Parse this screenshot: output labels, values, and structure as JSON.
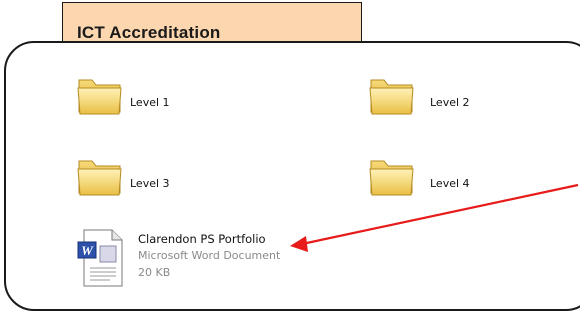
{
  "header": {
    "title": "ICT Accreditation"
  },
  "folders": [
    {
      "label": "Level 1",
      "icon": "folder-icon"
    },
    {
      "label": "Level 2",
      "icon": "folder-icon"
    },
    {
      "label": "Level 3",
      "icon": "folder-icon"
    },
    {
      "label": "Level 4",
      "icon": "folder-icon"
    }
  ],
  "document": {
    "name": "Clarendon PS Portfolio",
    "type": "Microsoft Word Document",
    "size": "20 KB",
    "icon": "word-document-icon"
  },
  "annotation": {
    "arrow_color": "#e81b1b"
  },
  "colors": {
    "title_bg": "#fbd6ae",
    "folder_yellow": "#f5d36a"
  }
}
